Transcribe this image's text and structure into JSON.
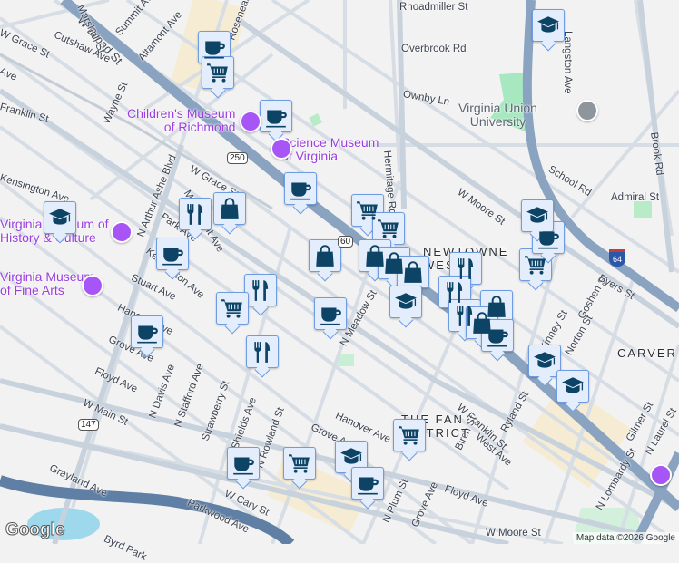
{
  "map": {
    "attribution": "Map data ©2026 Google",
    "logo": "Google",
    "route_shields": [
      "250",
      "60",
      "147",
      "64"
    ],
    "poi_labels": [
      "Children's Museum\nof Richmond",
      "Science Museum\nof Virginia",
      "Virginia Museum of\nHistory & Culture",
      "Virginia Museum\nof Fine Arts",
      "Virginia Union\nUniversity"
    ],
    "neighborhoods": [
      "NEWTOWNE\nWEST",
      "CARVER",
      "THE FAN\nDISTRICT"
    ],
    "streets": [
      "W Broad St",
      "Marshall St",
      "Summit Ave",
      "Altamont Ave",
      "W Grace St",
      "Cutshaw Ave",
      "Ave",
      "Franklin St",
      "Wayne St",
      "N Arthur Ashe Blvd",
      "W Grace St",
      "Kensington Ave",
      "Monument Ave",
      "Park Ave",
      "Kensington Ave",
      "Stuart Ave",
      "Hanover Ave",
      "Grove Ave",
      "Floyd Ave",
      "W Main St",
      "N Davis Ave",
      "N Stafford Ave",
      "Strawberry St",
      "N Shields Ave",
      "N Rowland St",
      "Grayland Ave",
      "W Cary St",
      "Parkwood Ave",
      "Rhoadmiller St",
      "Overbrook Rd",
      "Ownby Ln",
      "Hermitage Rd",
      "W Moore St",
      "Langston Ave",
      "School Rd",
      "Admiral St",
      "Brook Rd",
      "N Meadow St",
      "Hanover Ave",
      "Grove Ave",
      "W Franklin St",
      "Birch St",
      "West Ave",
      "Ryland St",
      "Kinney St",
      "Norton St",
      "Goshen St",
      "Gilmer St",
      "N Laurel St",
      "N Lombardy St",
      "N Plum St",
      "Grove Ave",
      "Floyd Ave",
      "W Moore St",
      "Byers St",
      "Roseneath Rd",
      "Byrd Park"
    ],
    "markers": [
      "coffee",
      "shopping-cart",
      "coffee",
      "coffee",
      "restaurant",
      "shopping-bag",
      "education",
      "coffee",
      "shopping-cart",
      "shopping-cart",
      "shopping-bag",
      "shopping-bag",
      "shopping-bag",
      "shopping-bag",
      "restaurant",
      "shopping-cart",
      "coffee",
      "education",
      "education",
      "restaurant",
      "shopping-cart",
      "restaurant",
      "coffee",
      "coffee",
      "education",
      "restaurant",
      "restaurant",
      "shopping-bag",
      "shopping-bag",
      "coffee",
      "education",
      "education",
      "shopping-cart",
      "education",
      "coffee",
      "coffee",
      "shopping-cart"
    ],
    "colors": {
      "marker_bg": "#e3edfc",
      "marker_border": "#6e9ce0",
      "icon": "#0d4465",
      "highway": "#8aa3c0",
      "poi": "#a855f7"
    }
  }
}
